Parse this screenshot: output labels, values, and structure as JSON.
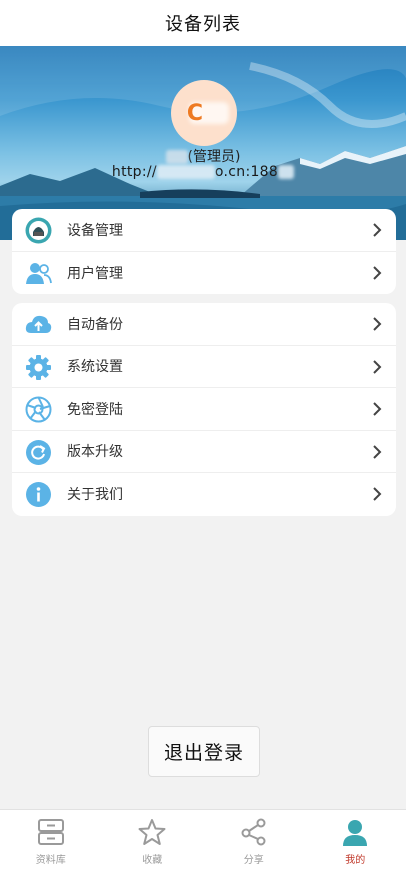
{
  "header": {
    "title": "设备列表"
  },
  "profile": {
    "avatar_letter": "C",
    "role": "(管理员)",
    "url_prefix": "http://",
    "url_middle": "o.cn:188"
  },
  "menu_group_1": [
    {
      "label": "设备管理",
      "icon": "device-management-icon"
    },
    {
      "label": "用户管理",
      "icon": "users-icon"
    }
  ],
  "menu_group_2": [
    {
      "label": "自动备份",
      "icon": "cloud-upload-icon"
    },
    {
      "label": "系统设置",
      "icon": "gear-icon"
    },
    {
      "label": "免密登陆",
      "icon": "aperture-icon"
    },
    {
      "label": "版本升级",
      "icon": "refresh-icon"
    },
    {
      "label": "关于我们",
      "icon": "info-icon"
    }
  ],
  "logout_label": "退出登录",
  "tabs": [
    {
      "label": "资料库",
      "icon": "drawer-icon"
    },
    {
      "label": "收藏",
      "icon": "star-icon"
    },
    {
      "label": "分享",
      "icon": "share-icon"
    },
    {
      "label": "我的",
      "icon": "person-icon",
      "active": true
    }
  ],
  "colors": {
    "icon_blue": "#5bb3e6",
    "tab_active": "#c0392b",
    "tab_inactive": "#9a9a9a",
    "person_active": "#3aa6b0"
  }
}
